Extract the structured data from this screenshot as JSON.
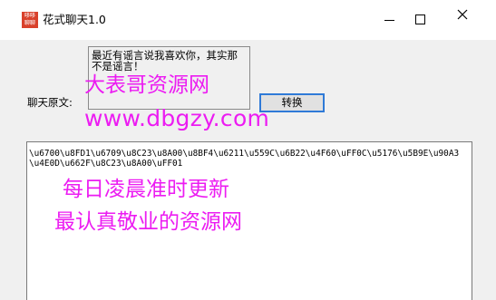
{
  "window": {
    "title": "花式聊天1.0",
    "icon_text": "哆哆\n聊聊",
    "minimize": "minimize",
    "maximize": "maximize",
    "close": "close"
  },
  "form": {
    "quote_text": "最近有谣言说我喜欢你，其实那不是谣言！",
    "original_label": "聊天原文:",
    "convert_button": "转换",
    "output_text": "\\u6700\\u8FD1\\u6709\\u8C23\\u8A00\\u8BF4\\u6211\\u559C\\u6B22\\u4F60\\uFF0C\\u5176\\u5B9E\\u90A3\\u4E0D\\u662F\\u8C23\\u8A00\\uFF01"
  },
  "watermark": {
    "line1": "大表哥资源网",
    "line2": "www.dbgzy.com",
    "line3": "每日凌晨准时更新",
    "line4": "最认真敬业的资源网"
  },
  "colors": {
    "watermark": "#ec1cf2",
    "button_focus_border": "#2f7ad7",
    "icon_bg": "#d9412b"
  }
}
